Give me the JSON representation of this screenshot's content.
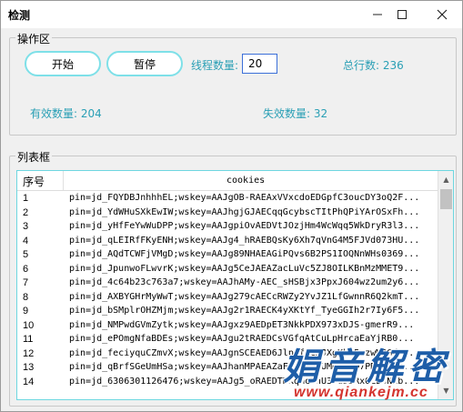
{
  "window": {
    "title": "检测"
  },
  "titlebar": {
    "min_icon": "minimize-icon",
    "max_icon": "maximize-icon",
    "close_icon": "close-icon"
  },
  "ops": {
    "group_label": "操作区",
    "start_label": "开始",
    "pause_label": "暂停",
    "threads_label": "线程数量:",
    "threads_value": "20",
    "total_label": "总行数: 236",
    "valid_label": "有效数量: 204",
    "invalid_label": "失效数量: 32"
  },
  "list": {
    "group_label": "列表框",
    "columns": {
      "index": "序号",
      "cookies": "cookies"
    },
    "rows": [
      {
        "i": "1",
        "v": "pin=jd_FQYDBJnhhhEL;wskey=AAJgOB-RAEAxVVxcdoEDGpfC3oucDY3oQ2F..."
      },
      {
        "i": "2",
        "v": "pin=jd_YdWHuSXkEwIW;wskey=AAJhgjGJAECqqGcybscTItPhQPiYArOSxFh..."
      },
      {
        "i": "3",
        "v": "pin=jd_yHfFeYwWuDPP;wskey=AAJgpiOvAEDVtJOzjHm4WcWqq5WkDryR3l3..."
      },
      {
        "i": "4",
        "v": "pin=jd_qLEIRfFKyENH;wskey=AAJg4_hRAEBQsKy6Xh7qVnG4M5FJVd073HU..."
      },
      {
        "i": "5",
        "v": "pin=jd_AQdTCWFjVMgD;wskey=AAJg89NHAEAGiPQvs6B2PS1IOQNnWHs0369..."
      },
      {
        "i": "6",
        "v": "pin=jd_JpunwoFLwvrK;wskey=AAJg5CeJAEAZacLuVc5ZJ8OILKBnMzMMET9..."
      },
      {
        "i": "7",
        "v": "pin=jd_4c64b23c763a7;wskey=AAJhAMy-AEC_sHSBjx3PpxJ604wz2um2y6..."
      },
      {
        "i": "8",
        "v": "pin=jd_AXBYGHrMyWwT;wskey=AAJg279cAECcRWZy2YvJZ1LfGwnnR6Q2kmT..."
      },
      {
        "i": "9",
        "v": "pin=jd_bSMplrOHZMjm;wskey=AAJg2r1RAECK4yXKtYf_TyeGGIh2r7Iy6F5..."
      },
      {
        "i": "10",
        "v": "pin=jd_NMPwdGVmZytk;wskey=AAJgxz9AEDpET3NkkPDX973xDJS-gmerR9..."
      },
      {
        "i": "11",
        "v": "pin=jd_ePOmgNfaBDEs;wskey=AAJgu2tRAEDCsVGfqAtCuLpHrcaEaYjRB0..."
      },
      {
        "i": "12",
        "v": "pin=jd_feciyquCZmvX;wskey=AAJgnSCEAED6JlpFfrCmJXgKhh5ozwMBGd..."
      },
      {
        "i": "13",
        "v": "pin=jd_qBrfSGeUmHSa;wskey=AAJhanMPAEAZaFFpc-AnUMKi43M7PDT-LSY..."
      },
      {
        "i": "14",
        "v": "pin=jd_6306301126476;wskey=AAJg5_oRAEDTHKqmcTnU3JuDJRxOLE3NZb..."
      }
    ]
  },
  "watermark": {
    "title": "娟音解密",
    "url": "www.qiankejm.cc"
  },
  "scroll": {
    "up_icon": "scroll-up-icon",
    "down_icon": "scroll-down-icon"
  }
}
